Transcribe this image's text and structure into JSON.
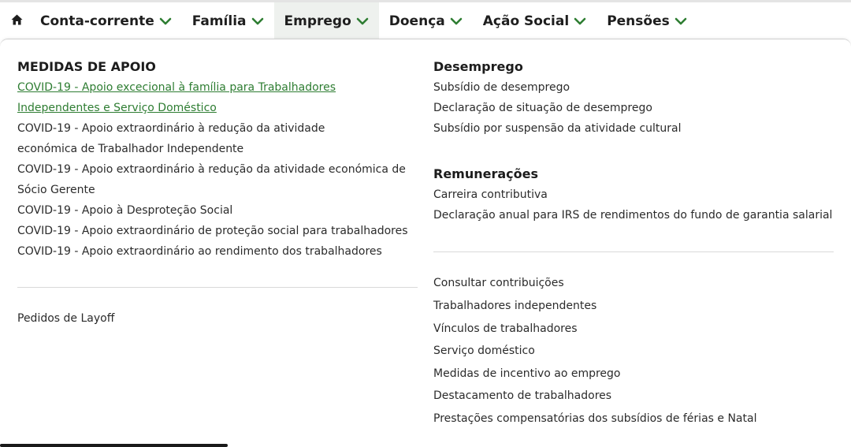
{
  "nav": {
    "home_icon": "home-icon",
    "items": [
      {
        "label": "Conta-corrente"
      },
      {
        "label": "Família"
      },
      {
        "label": "Emprego"
      },
      {
        "label": "Doença"
      },
      {
        "label": "Ação Social"
      },
      {
        "label": "Pensões"
      }
    ],
    "active": "Emprego",
    "chevron_icon": "chevron-down-icon"
  },
  "colors": {
    "accent": "#2e7d32",
    "text": "#222222",
    "divider": "#d9d9d9",
    "active_tab_bg": "#eef1ee"
  },
  "left": {
    "heading": "MEDIDAS DE APOIO",
    "links": [
      "COVID-19 - Apoio excecional à família para Trabalhadores Independentes e Serviço Doméstico",
      "COVID-19 - Apoio extraordinário à redução da atividade económica de Trabalhador Independente",
      "COVID-19 - Apoio extraordinário à redução da atividade económica de Sócio Gerente",
      "COVID-19 - Apoio à Desproteção Social",
      "COVID-19 - Apoio extraordinário de proteção social para trabalhadores",
      "COVID-19 - Apoio extraordinário ao rendimento dos trabalhadores"
    ],
    "extra_link": "Pedidos de Layoff"
  },
  "right": {
    "desemprego": {
      "heading": "Desemprego",
      "links": [
        "Subsídio de desemprego",
        "Declaração de situação de desemprego",
        "Subsídio por suspensão da atividade cultural"
      ]
    },
    "remuneracoes": {
      "heading": "Remunerações",
      "links": [
        "Carreira contributiva",
        "Declaração anual para IRS de rendimentos do fundo de garantia salarial"
      ]
    },
    "other_links": [
      "Consultar contribuições",
      "Trabalhadores independentes",
      "Vínculos de trabalhadores",
      "Serviço doméstico",
      "Medidas de incentivo ao emprego",
      "Destacamento de trabalhadores",
      "Prestações compensatórias dos subsídios de férias e Natal"
    ]
  }
}
